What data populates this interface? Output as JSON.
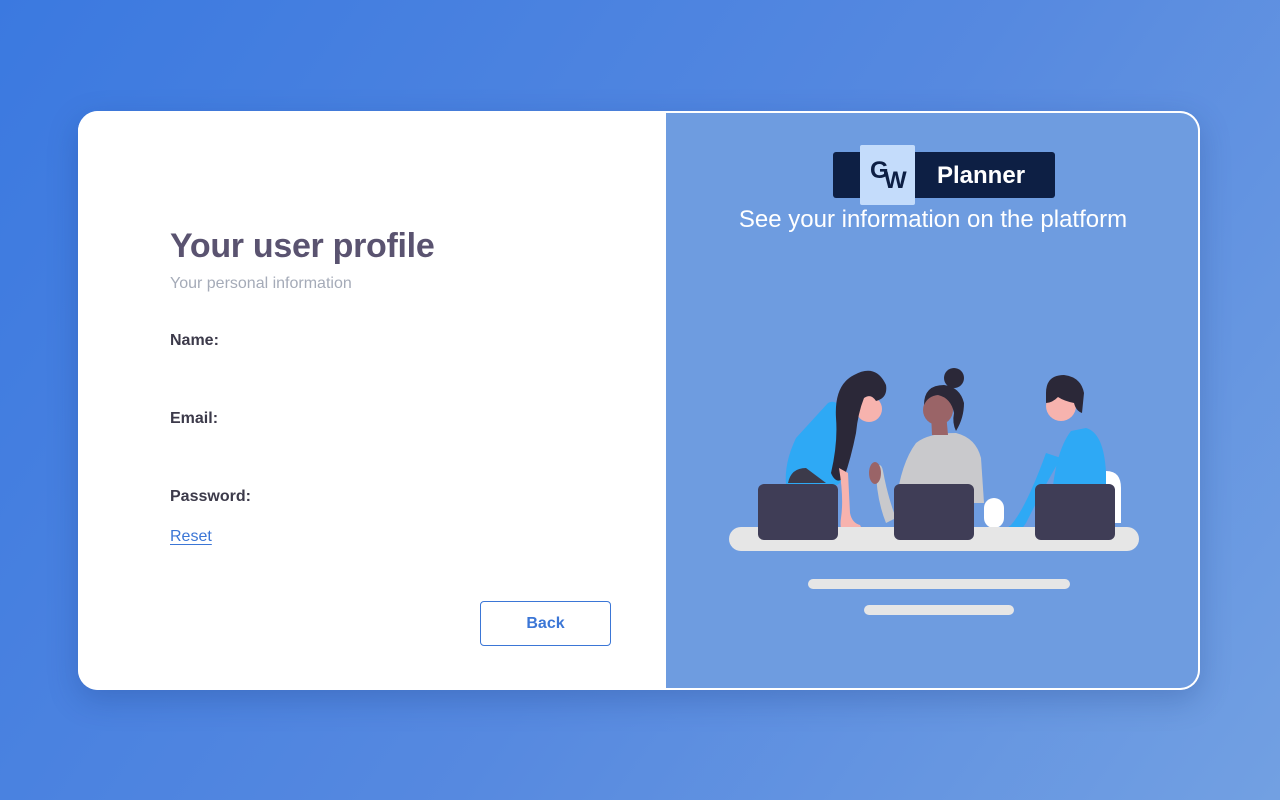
{
  "profile": {
    "title": "Your user profile",
    "subtitle": "Your personal information",
    "fields": {
      "name_label": "Name:",
      "email_label": "Email:",
      "password_label": "Password:"
    },
    "reset_label": "Reset",
    "back_label": "Back"
  },
  "brand": {
    "logo_letter_1": "G",
    "logo_letter_2": "W",
    "app_name": "Planner",
    "tagline": "See your information on the platform"
  },
  "colors": {
    "background": "#4a85e0",
    "accent": "#3b76d6",
    "panel": "#6e9ce0",
    "logo_dark": "#0d1f44",
    "logo_light": "#c4dcfb"
  },
  "icons": {
    "illustration": "team-working-illustration"
  }
}
